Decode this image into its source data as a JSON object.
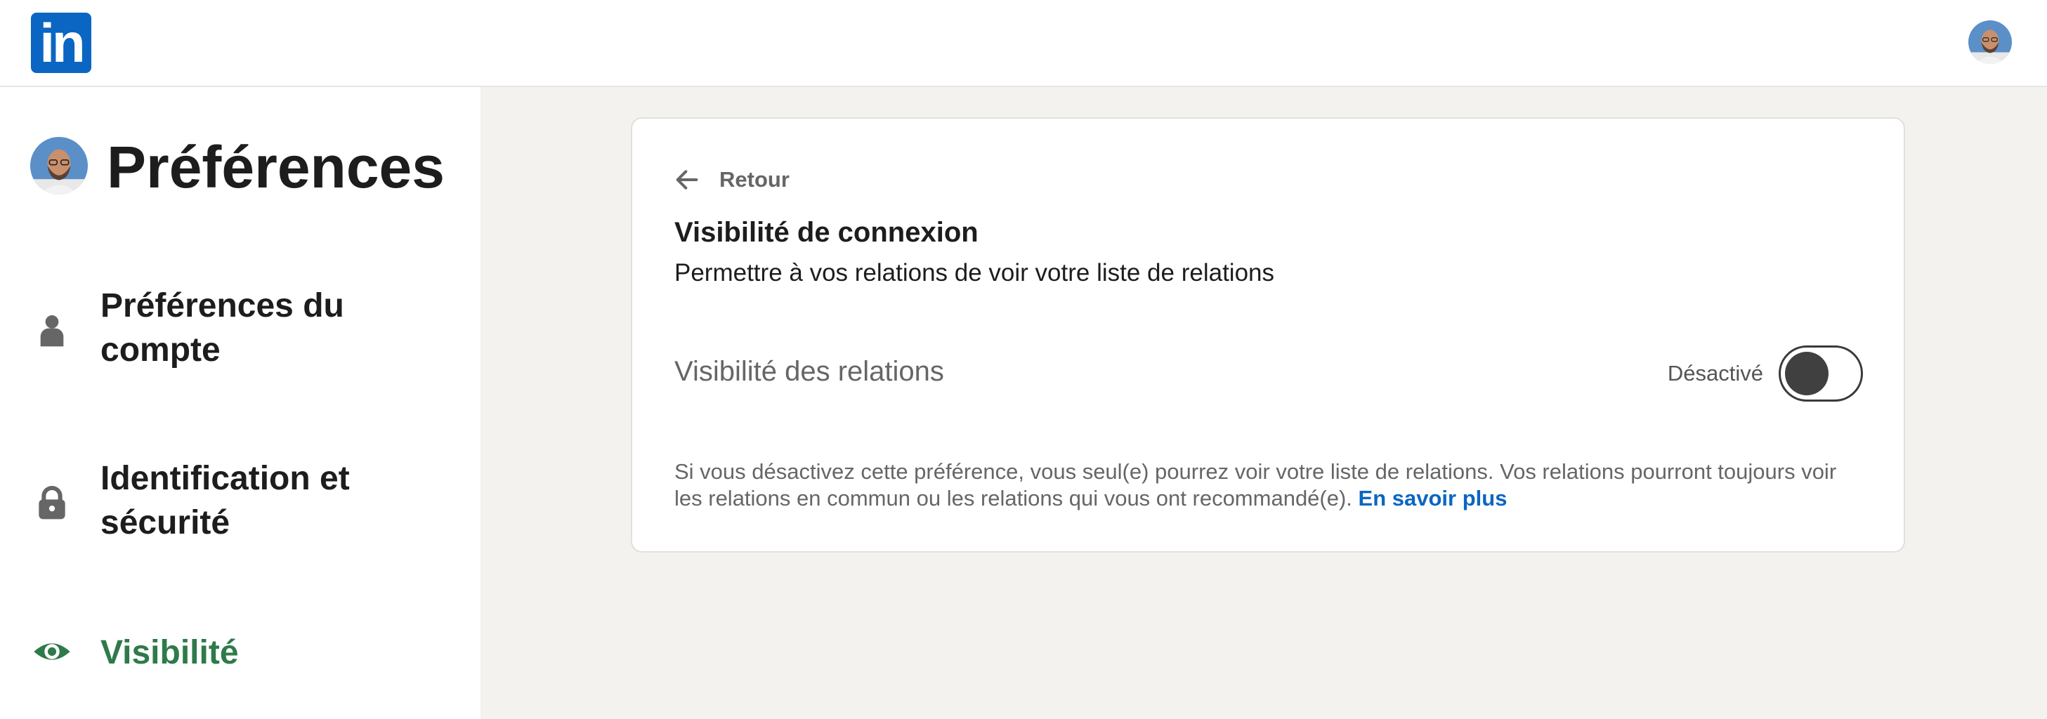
{
  "header": {
    "logo_text": "in",
    "brand_color": "#0a66c2"
  },
  "sidebar": {
    "title": "Préférences",
    "items": [
      {
        "label": "Préférences du compte",
        "icon": "person-icon",
        "active": false
      },
      {
        "label": "Identification et sécurité",
        "icon": "lock-icon",
        "active": false
      },
      {
        "label": "Visibilité",
        "icon": "eye-icon",
        "active": true,
        "color": "#2f7a4a"
      }
    ]
  },
  "main": {
    "back_label": "Retour",
    "section_title": "Visibilité de connexion",
    "section_description": "Permettre à vos relations de voir votre liste de relations",
    "setting": {
      "label": "Visibilité des relations",
      "status": "Désactivé",
      "enabled": false
    },
    "help": {
      "text": "Si vous désactivez cette préférence, vous seul(e) pourrez voir votre liste de relations. Vos relations pourront toujours voir les relations en commun ou les relations qui vous ont recommandé(e). ",
      "link": "En savoir plus",
      "link_color": "#0a66c2"
    }
  }
}
